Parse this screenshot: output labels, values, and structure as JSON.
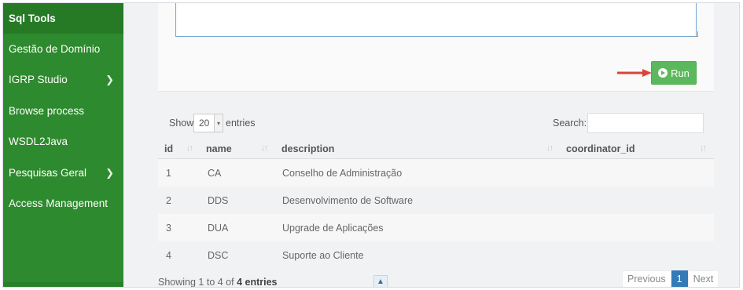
{
  "sidebar": {
    "items": [
      {
        "label": "Sql Tools",
        "active": true,
        "has_submenu": false
      },
      {
        "label": "Gestão de Domínio",
        "active": false,
        "has_submenu": false
      },
      {
        "label": "IGRP Studio",
        "active": false,
        "has_submenu": true
      },
      {
        "label": "Browse process",
        "active": false,
        "has_submenu": false
      },
      {
        "label": "WSDL2Java",
        "active": false,
        "has_submenu": false
      },
      {
        "label": "Pesquisas Geral",
        "active": false,
        "has_submenu": true
      },
      {
        "label": "Access Management",
        "active": false,
        "has_submenu": false
      }
    ],
    "chevron_icon": "chevron-right-icon"
  },
  "query": {
    "textarea_value": "",
    "run_label": "Run",
    "run_icon": "play-circle-icon"
  },
  "table_controls": {
    "show_label": "Show",
    "page_size": "20",
    "entries_label": "entries",
    "search_label": "Search:",
    "search_value": ""
  },
  "table": {
    "columns": [
      "id",
      "name",
      "description",
      "coordinator_id"
    ],
    "rows": [
      {
        "id": "1",
        "name": "CA",
        "description": "Conselho de Administração",
        "coordinator_id": ""
      },
      {
        "id": "2",
        "name": "DDS",
        "description": "Desenvolvimento de Software",
        "coordinator_id": ""
      },
      {
        "id": "3",
        "name": "DUA",
        "description": "Upgrade de Aplicações",
        "coordinator_id": ""
      },
      {
        "id": "4",
        "name": "DSC",
        "description": "Suporte ao Cliente",
        "coordinator_id": ""
      }
    ]
  },
  "footer": {
    "info_prefix": "Showing 1 to 4 of ",
    "info_bold": "4 entries",
    "pagination": {
      "previous": "Previous",
      "current": "1",
      "next": "Next"
    }
  },
  "colors": {
    "sidebar": "#2e8a2e",
    "run_button": "#5cb85c",
    "annotation_arrow": "#d9433a",
    "active_page": "#337ab7"
  }
}
